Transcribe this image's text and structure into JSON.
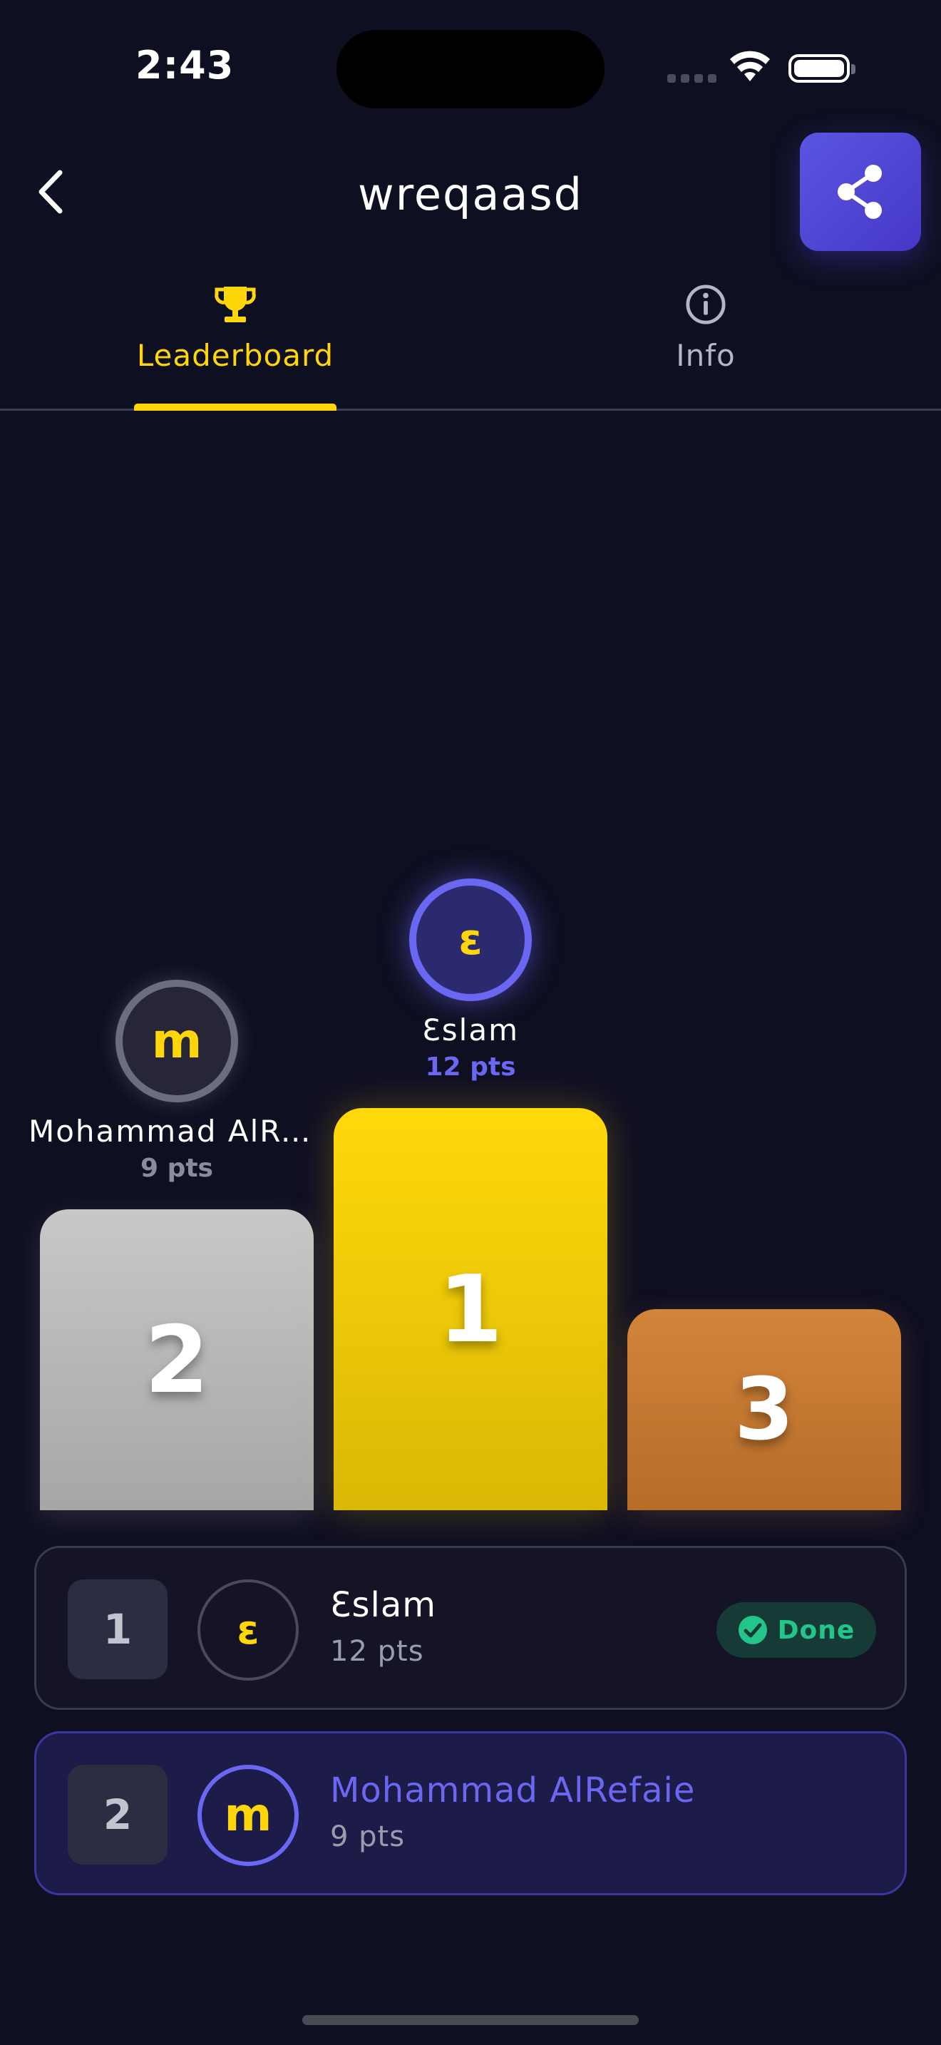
{
  "status_bar": {
    "time": "2:43"
  },
  "header": {
    "title": "wreqaasd"
  },
  "tabs": [
    {
      "label": "Leaderboard",
      "icon": "trophy-icon",
      "active": true
    },
    {
      "label": "Info",
      "icon": "info-icon",
      "active": false
    }
  ],
  "podium": {
    "first": {
      "initial": "ɛ",
      "name": "Ɛslam",
      "points": "12 pts",
      "rank": "1"
    },
    "second": {
      "initial": "m",
      "name": "Mohammad AlRefaie",
      "points": "9 pts",
      "rank": "2"
    },
    "third": {
      "rank": "3"
    }
  },
  "leaderboard": [
    {
      "rank": "1",
      "initial": "ɛ",
      "name": "Ɛslam",
      "points": "12 pts",
      "status": "Done"
    },
    {
      "rank": "2",
      "initial": "m",
      "name": "Mohammad AlRefaie",
      "points": "9 pts"
    }
  ],
  "colors": {
    "background": "#0f0f22",
    "accent_yellow": "#ffd60a",
    "accent_purple": "#6a67f2",
    "silver": "#b8b8b8",
    "bronze": "#c87a32",
    "done_green": "#23c58a"
  }
}
